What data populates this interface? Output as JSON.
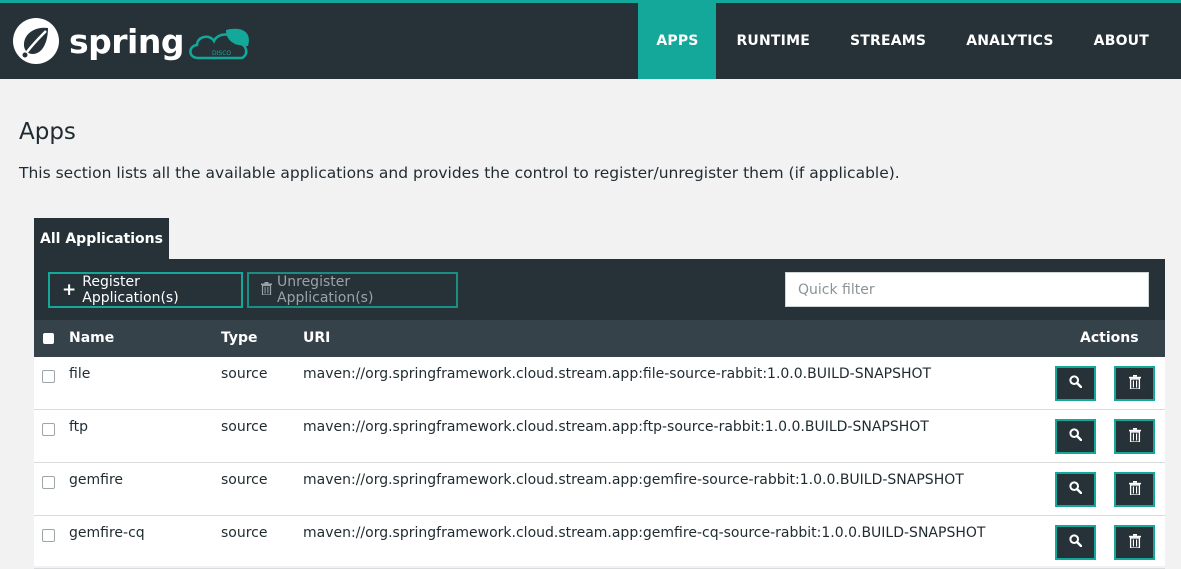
{
  "header": {
    "brand": "spring",
    "brand_badge": "DISCO",
    "nav": [
      {
        "label": "APPS",
        "active": true
      },
      {
        "label": "RUNTIME",
        "active": false
      },
      {
        "label": "STREAMS",
        "active": false
      },
      {
        "label": "ANALYTICS",
        "active": false
      },
      {
        "label": "ABOUT",
        "active": false
      }
    ]
  },
  "page": {
    "title": "Apps",
    "description": "This section lists all the available applications and provides the control to register/unregister them (if applicable)."
  },
  "tabs": [
    {
      "label": "All Applications",
      "active": true
    }
  ],
  "toolbar": {
    "register_label": "Register Application(s)",
    "unregister_label": "Unregister Application(s)",
    "filter_placeholder": "Quick filter"
  },
  "table": {
    "columns": {
      "name": "Name",
      "type": "Type",
      "uri": "URI",
      "actions": "Actions"
    },
    "rows": [
      {
        "name": "file",
        "type": "source",
        "uri": "maven://org.springframework.cloud.stream.app:file-source-rabbit:1.0.0.BUILD-SNAPSHOT"
      },
      {
        "name": "ftp",
        "type": "source",
        "uri": "maven://org.springframework.cloud.stream.app:ftp-source-rabbit:1.0.0.BUILD-SNAPSHOT"
      },
      {
        "name": "gemfire",
        "type": "source",
        "uri": "maven://org.springframework.cloud.stream.app:gemfire-source-rabbit:1.0.0.BUILD-SNAPSHOT"
      },
      {
        "name": "gemfire-cq",
        "type": "source",
        "uri": "maven://org.springframework.cloud.stream.app:gemfire-cq-source-rabbit:1.0.0.BUILD-SNAPSHOT"
      }
    ],
    "row_actions": [
      "search-icon",
      "trash-icon"
    ]
  },
  "colors": {
    "accent": "#14a89a",
    "header_bg": "#263238",
    "table_head_bg": "#35424a",
    "page_bg": "#f2f2f2"
  }
}
